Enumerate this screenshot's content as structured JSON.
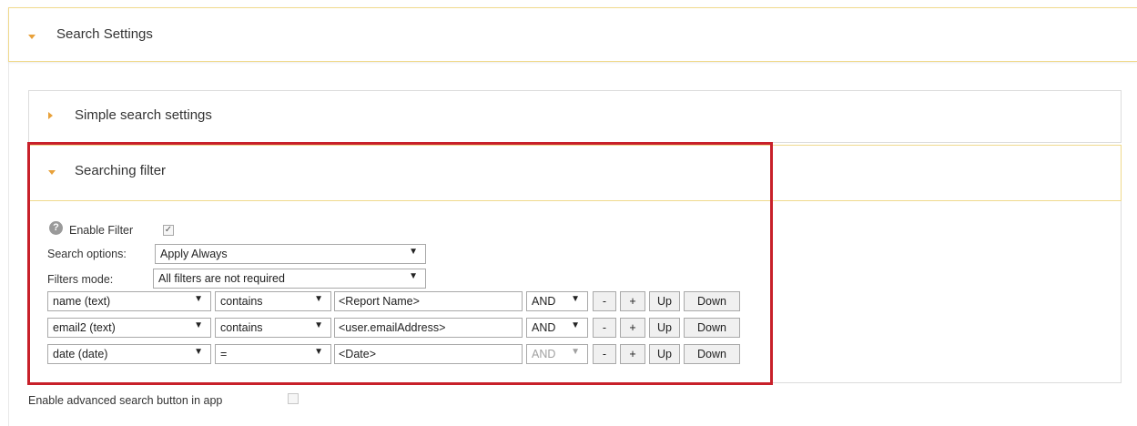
{
  "search_settings": {
    "title": "Search Settings"
  },
  "simple_search": {
    "title": "Simple search settings"
  },
  "searching_filter": {
    "title": "Searching filter",
    "enable_filter": {
      "label": "Enable Filter",
      "checked": true
    },
    "search_options": {
      "label": "Search options:",
      "value": "Apply Always"
    },
    "filters_mode": {
      "label": "Filters mode:",
      "value": "All filters are not required"
    },
    "rows": [
      {
        "field": "name (text)",
        "operator": "contains",
        "value": "<Report Name>",
        "logic": "AND",
        "logic_disabled": false
      },
      {
        "field": "email2 (text)",
        "operator": "contains",
        "value": "<user.emailAddress>",
        "logic": "AND",
        "logic_disabled": false
      },
      {
        "field": "date (date)",
        "operator": "=",
        "value": "<Date>",
        "logic": "AND",
        "logic_disabled": true
      }
    ],
    "buttons": {
      "minus": "-",
      "plus": "+",
      "up": "Up",
      "down": "Down"
    },
    "help_icon": "question-circle-icon",
    "caret_glyph": "▼",
    "check_glyph": "✓"
  },
  "advanced_search": {
    "label": "Enable advanced search button in app",
    "checked": false
  },
  "colors": {
    "accent_arrow": "#e8a13a",
    "highlight": "#c8202a",
    "header_border": "#f0d98c"
  }
}
